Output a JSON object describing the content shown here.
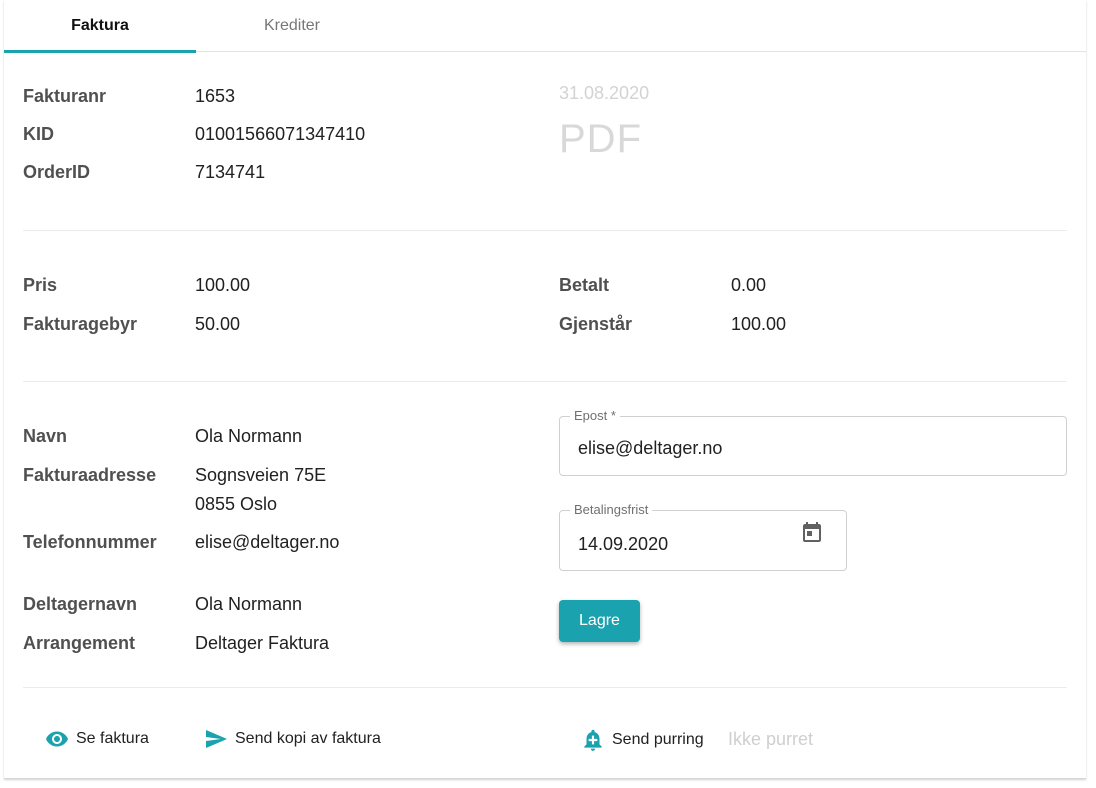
{
  "tabs": [
    {
      "label": "Faktura"
    },
    {
      "label": "Krediter"
    }
  ],
  "invoice": {
    "fakturanr_label": "Fakturanr",
    "fakturanr": "1653",
    "kid_label": "KID",
    "kid": "01001566071347410",
    "orderid_label": "OrderID",
    "orderid": "7134741",
    "date": "31.08.2020",
    "pdf": "PDF"
  },
  "amounts": {
    "pris_label": "Pris",
    "pris": "100.00",
    "gebyr_label": "Fakturagebyr",
    "gebyr": "50.00",
    "betalt_label": "Betalt",
    "betalt": "0.00",
    "gjenstar_label": "Gjenstår",
    "gjenstar": "100.00"
  },
  "customer": {
    "navn_label": "Navn",
    "navn": "Ola Normann",
    "adresse_label": "Fakturaadresse",
    "adresse_line1": "Sognsveien 75E",
    "adresse_line2": "0855 Oslo",
    "telefon_label": "Telefonnummer",
    "telefon": "elise@deltager.no",
    "deltager_label": "Deltagernavn",
    "deltager": "Ola Normann",
    "arrangement_label": "Arrangement",
    "arrangement": "Deltager Faktura"
  },
  "form": {
    "epost_label": "Epost *",
    "epost_value": "elise@deltager.no",
    "frist_label": "Betalingsfrist",
    "frist_value": "14.09.2020",
    "save_label": "Lagre"
  },
  "actions": {
    "view_label": "Se faktura",
    "send_copy_label": "Send kopi av faktura",
    "reminder_label": "Send purring",
    "reminder_status": "Ikke purret"
  },
  "colors": {
    "accent": "#1aa3af"
  },
  "icons": {
    "view": "eye-icon",
    "send": "send-icon",
    "reminder": "bell-plus-icon",
    "calendar": "calendar-icon"
  }
}
